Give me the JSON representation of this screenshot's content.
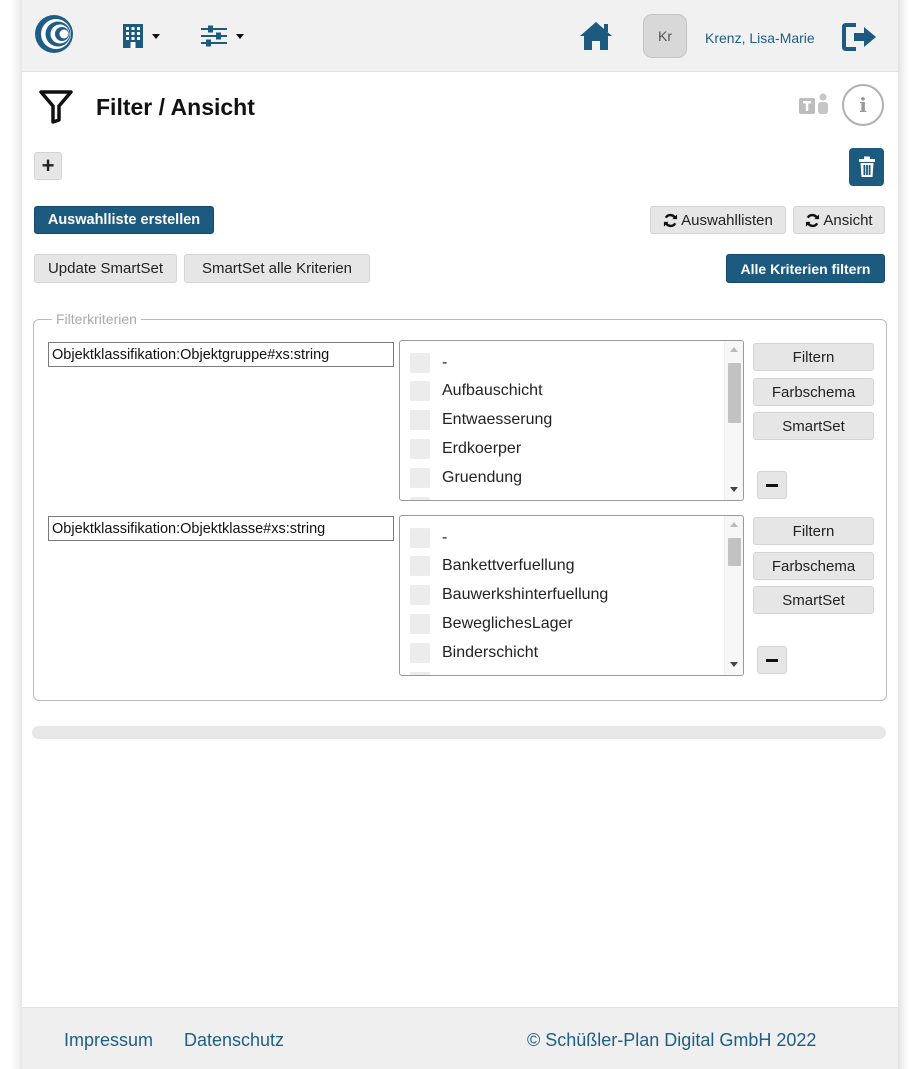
{
  "header": {
    "user_initials": "Kr",
    "user_name": "Krenz, Lisa-Marie"
  },
  "page": {
    "title": "Filter / Ansicht"
  },
  "toolbar": {
    "add_label": "+",
    "create_list_label": "Auswahlliste erstellen",
    "refresh_lists_label": "Auswahllisten",
    "refresh_view_label": "Ansicht",
    "update_smartset_label": "Update SmartSet",
    "smartset_all_label": "SmartSet alle Kriterien",
    "filter_all_label": "Alle Kriterien filtern"
  },
  "filter": {
    "legend": "Filterkriterien",
    "criteria": [
      {
        "field": "Objektklassifikation:Objektgruppe#xs:string",
        "options": [
          "-",
          "Aufbauschicht",
          "Entwaesserung",
          "Erdkoerper",
          "Gruendung"
        ],
        "buttons": {
          "filter": "Filtern",
          "color": "Farbschema",
          "smartset": "SmartSet"
        }
      },
      {
        "field": "Objektklassifikation:Objektklasse#xs:string",
        "options": [
          "-",
          "Bankettverfuellung",
          "Bauwerkshinterfuellung",
          "BeweglichesLager",
          "Binderschicht"
        ],
        "buttons": {
          "filter": "Filtern",
          "color": "Farbschema",
          "smartset": "SmartSet"
        }
      }
    ]
  },
  "footer": {
    "impressum": "Impressum",
    "datenschutz": "Datenschutz",
    "copyright": "© Schüßler-Plan Digital GmbH 2022"
  },
  "colors": {
    "primary": "#1d5a80",
    "link": "#1e5e85",
    "topbar_bg": "#f1f1f1"
  },
  "icons": {
    "logo": "swirl-logo",
    "building": "building-icon",
    "settings": "sliders-icon",
    "home": "home-icon",
    "logout": "logout-icon",
    "filter": "funnel-icon",
    "teams": "teams-icon",
    "info": "info-icon",
    "delete": "trash-icon",
    "refresh": "refresh-icon"
  }
}
